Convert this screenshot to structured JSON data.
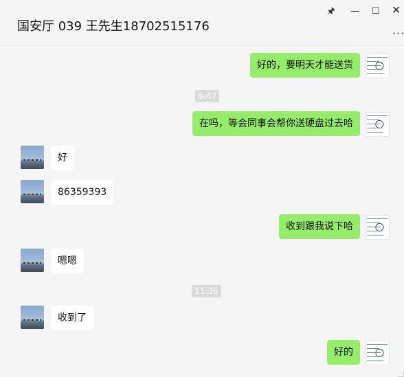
{
  "window": {
    "title": "国安厅 039 王先生18702515176",
    "controls": {
      "pin": "🖈",
      "minimize": "—",
      "maximize": "☐",
      "close": "✕"
    },
    "more": "···"
  },
  "messages": [
    {
      "type": "text",
      "side": "right",
      "text": "好的，要明天才能送货"
    },
    {
      "type": "time",
      "text": "8:47"
    },
    {
      "type": "text",
      "side": "right",
      "text": "在吗，等会同事会帮你送硬盘过去哈"
    },
    {
      "type": "text",
      "side": "left",
      "text": "好"
    },
    {
      "type": "text",
      "side": "left",
      "text": "86359393"
    },
    {
      "type": "text",
      "side": "right",
      "text": "收到跟我说下哈"
    },
    {
      "type": "text",
      "side": "left",
      "text": "嗯嗯"
    },
    {
      "type": "time",
      "text": "11:36"
    },
    {
      "type": "text",
      "side": "left",
      "text": "收到了"
    },
    {
      "type": "text",
      "side": "right",
      "text": "好的"
    }
  ],
  "colors": {
    "accent_bubble": "#95ec69",
    "incoming_bubble": "#ffffff",
    "background": "#f5f5f5",
    "timestamp_bg": "#dadada"
  }
}
